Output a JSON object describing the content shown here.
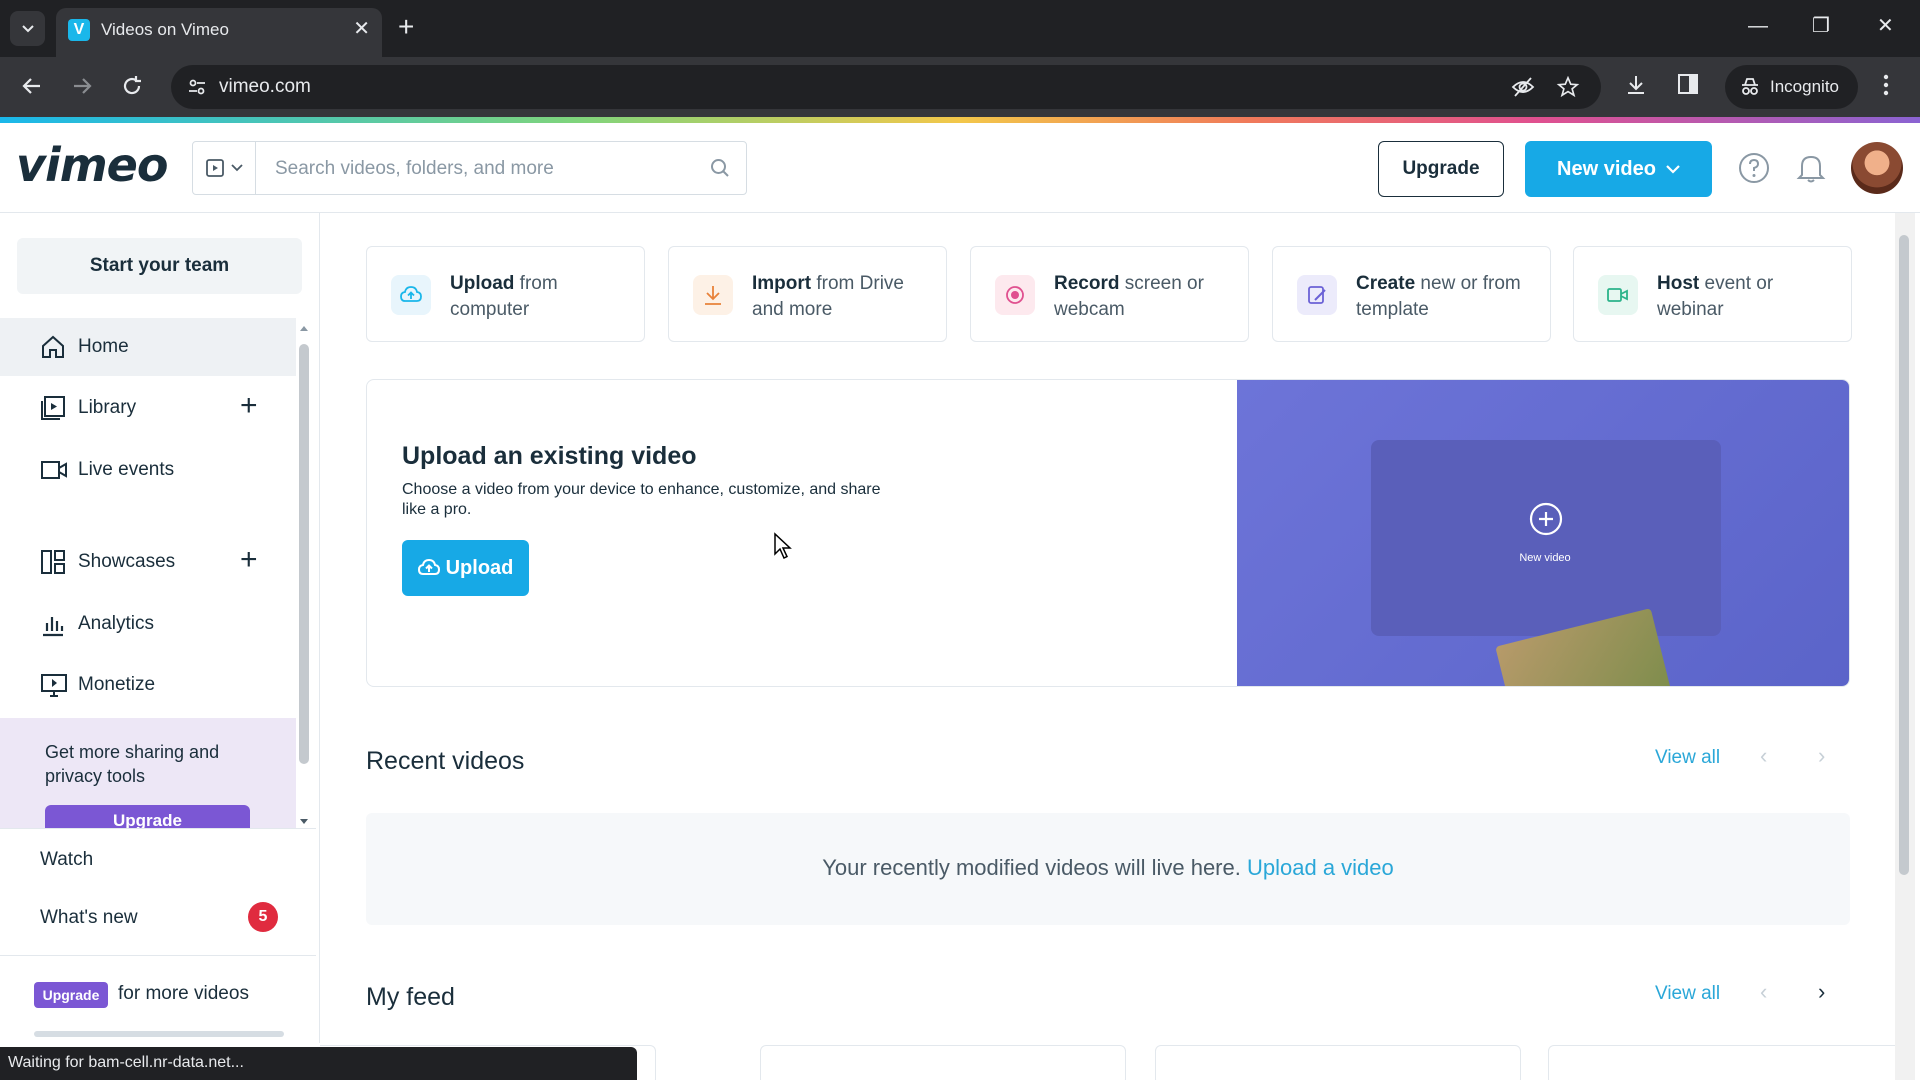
{
  "browser": {
    "tab_title": "Videos on Vimeo",
    "favicon_letter": "V",
    "url": "vimeo.com",
    "incognito_label": "Incognito",
    "status_text": "Waiting for bam-cell.nr-data.net..."
  },
  "header": {
    "logo": "vimeo",
    "search_placeholder": "Search videos, folders, and more",
    "upgrade_label": "Upgrade",
    "new_video_label": "New video"
  },
  "sidebar": {
    "team_button": "Start your team",
    "items": [
      {
        "label": "Home",
        "icon": "home-icon"
      },
      {
        "label": "Library",
        "icon": "library-icon"
      },
      {
        "label": "Live events",
        "icon": "camera-icon"
      },
      {
        "label": "Showcases",
        "icon": "showcases-icon"
      },
      {
        "label": "Analytics",
        "icon": "analytics-icon"
      },
      {
        "label": "Monetize",
        "icon": "monetize-icon"
      }
    ],
    "promo_text": "Get more sharing and privacy tools",
    "promo_button": "Upgrade",
    "watch_label": "Watch",
    "whats_new_label": "What's new",
    "whats_new_count": "5",
    "upgrade_tag": "Upgrade",
    "upgrade_text": "for more videos"
  },
  "quick_actions": [
    {
      "bold": "Upload",
      "rest": " from computer",
      "color": "#e8f5fc"
    },
    {
      "bold": "Import",
      "rest": " from Drive and more",
      "color": "#fdf1e6"
    },
    {
      "bold": "Record",
      "rest": " screen or webcam",
      "color": "#fde9ee"
    },
    {
      "bold": "Create",
      "rest": " new or from template",
      "color": "#ecebfb"
    },
    {
      "bold": "Host",
      "rest": " event or webinar",
      "color": "#e7f7f1"
    }
  ],
  "upload_card": {
    "title": "Upload an existing video",
    "description": "Choose a video from your device to enhance, customize, and share like a pro.",
    "button": "Upload",
    "art_label": "New video"
  },
  "recent": {
    "title": "Recent videos",
    "view_all": "View all",
    "empty_text": "Your recently modified videos will live here.",
    "empty_link": "Upload a video"
  },
  "feed": {
    "title": "My feed",
    "view_all": "View all"
  },
  "colors": {
    "accent": "#17a9e6",
    "purple": "#7b57d4",
    "badge_red": "#e02b3f"
  }
}
